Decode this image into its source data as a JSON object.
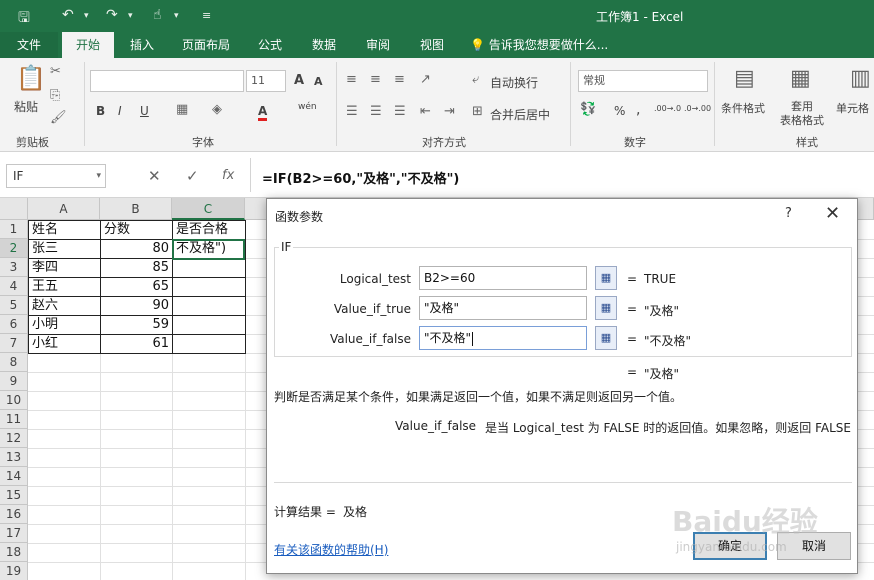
{
  "window": {
    "title": "工作簿1 - Excel"
  },
  "quick_access": {
    "save": "save-icon",
    "undo": "undo-icon",
    "redo": "redo-icon",
    "touch": "touch-icon",
    "customize": "customize-icon"
  },
  "tabs": [
    "文件",
    "开始",
    "插入",
    "页面布局",
    "公式",
    "数据",
    "审阅",
    "视图"
  ],
  "tell_me": "告诉我您想要做什么...",
  "ribbon": {
    "clipboard": {
      "paste": "粘贴",
      "label": "剪贴板"
    },
    "font": {
      "font_size": "11",
      "label": "字体",
      "bold": "B",
      "italic": "I",
      "underline": "U",
      "grow": "A",
      "shrink": "A",
      "color": "A",
      "wen": "wén"
    },
    "alignment": {
      "wrap": "自动换行",
      "merge": "合并后居中",
      "label": "对齐方式"
    },
    "number": {
      "format": "常规",
      "label": "数字",
      "percent": "%",
      "comma": ",",
      "inc_decimal": ".00→.0",
      "dec_decimal": ".0→.00"
    },
    "styles": {
      "conditional": "条件格式",
      "table_format": "套用\n表格格式",
      "cell_styles": "单元格",
      "label": "样式"
    }
  },
  "formula_bar": {
    "name_box": "IF",
    "formula": "=IF(B2>=60,\"及格\",\"不及格\")",
    "cancel": "✕",
    "enter": "✓",
    "fx": "fx"
  },
  "sheet": {
    "columns": [
      "A",
      "B",
      "C"
    ],
    "rows": [
      "1",
      "2",
      "3",
      "4",
      "5",
      "6",
      "7",
      "8",
      "9",
      "10",
      "11",
      "12",
      "13",
      "14",
      "15",
      "16",
      "17",
      "18",
      "19"
    ],
    "data": [
      [
        "姓名",
        "分数",
        "是否合格"
      ],
      [
        "张三",
        "80",
        "不及格\")"
      ],
      [
        "李四",
        "85",
        ""
      ],
      [
        "王五",
        "65",
        ""
      ],
      [
        "赵六",
        "90",
        ""
      ],
      [
        "小明",
        "59",
        ""
      ],
      [
        "小红",
        "61",
        ""
      ]
    ]
  },
  "dialog": {
    "title": "函数参数",
    "help": "?",
    "close": "✕",
    "function_name": "IF",
    "args": [
      {
        "label": "Logical_test",
        "value": "B2>=60",
        "result": "TRUE"
      },
      {
        "label": "Value_if_true",
        "value": "\"及格\"",
        "result": "\"及格\""
      },
      {
        "label": "Value_if_false",
        "value": "\"不及格\"",
        "result": "\"不及格\""
      }
    ],
    "overall_result": "\"及格\"",
    "description": "判断是否满足某个条件，如果满足返回一个值，如果不满足则返回另一个值。",
    "arg_help_name": "Value_if_false",
    "arg_help_text": "是当 Logical_test 为 FALSE 时的返回值。如果忽略，则返回 FALSE",
    "calc_label": "计算结果 =",
    "calc_value": "及格",
    "help_link": "有关该函数的帮助(H)",
    "ok": "确定",
    "cancel": "取消"
  },
  "watermark": {
    "text": "Baidu经验",
    "sub": "jingyan.baidu.com"
  }
}
